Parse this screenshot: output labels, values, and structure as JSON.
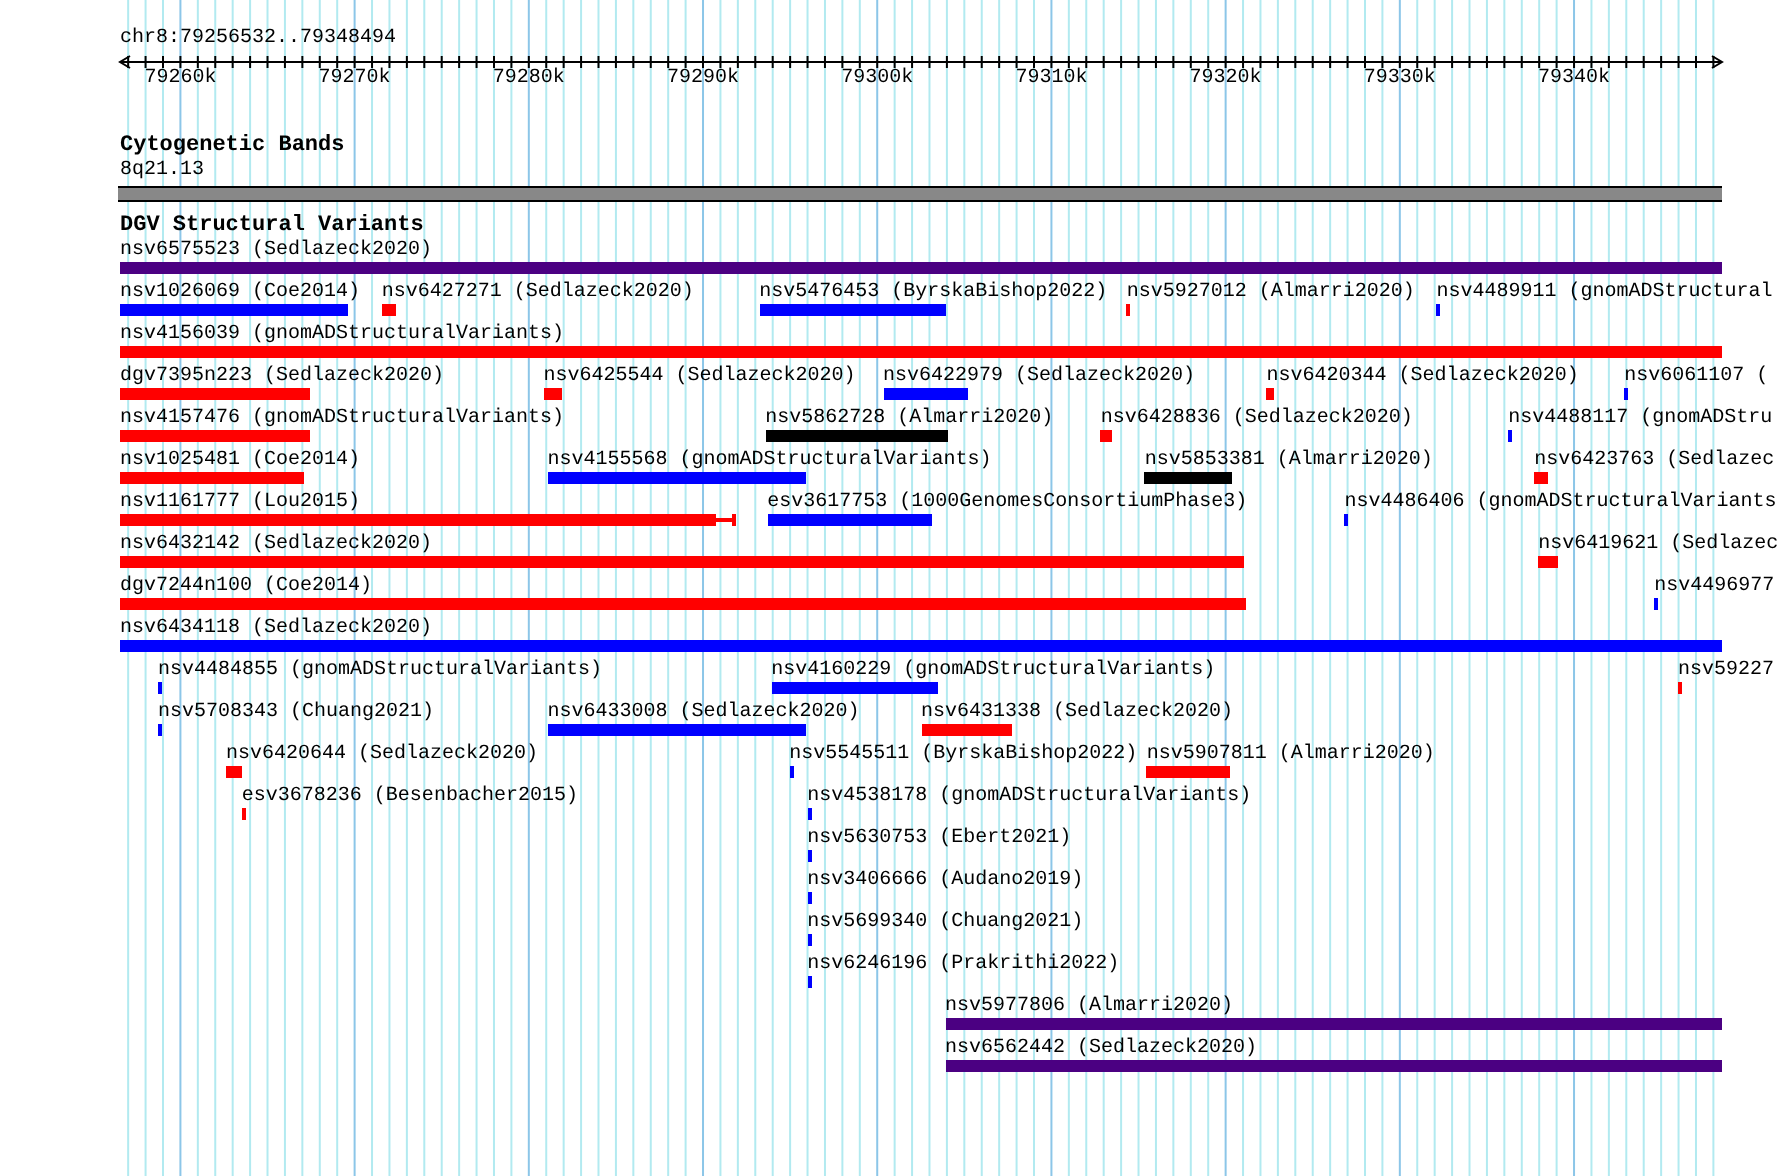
{
  "ruler": {
    "location": "chr8:79256532..79348494",
    "ticks": [
      {
        "label": "79260k"
      },
      {
        "label": "79270k"
      },
      {
        "label": "79280k"
      },
      {
        "label": "79290k"
      },
      {
        "label": "79300k"
      },
      {
        "label": "79310k"
      },
      {
        "label": "79320k"
      },
      {
        "label": "79330k"
      },
      {
        "label": "79340k"
      }
    ]
  },
  "cytogenetic_bands": {
    "title": "Cytogenetic Bands",
    "bands": [
      {
        "name": "8q21.13"
      }
    ]
  },
  "structural_variants": {
    "title": "DGV Structural Variants",
    "lanes": [
      {
        "features": [
          {
            "label": "nsv6575523 (Sedlazeck2020)",
            "color": "#4b0082"
          }
        ]
      },
      {
        "features": [
          {
            "label": "nsv1026069 (Coe2014)",
            "color": "#0000ff"
          },
          {
            "label": "nsv6427271 (Sedlazeck2020)",
            "color": "#ff0000"
          },
          {
            "label": "nsv5476453 (ByrskaBishop2022)",
            "color": "#0000ff"
          },
          {
            "label": "nsv5927012 (Almarri2020)",
            "color": "#ff0000"
          },
          {
            "label": "nsv4489911 (gnomADStructural",
            "color": "#0000ff"
          }
        ]
      },
      {
        "features": [
          {
            "label": "nsv4156039 (gnomADStructuralVariants)",
            "color": "#ff0000"
          }
        ]
      },
      {
        "features": [
          {
            "label": "dgv7395n223 (Sedlazeck2020)",
            "color": "#ff0000"
          },
          {
            "label": "nsv6425544 (Sedlazeck2020)",
            "color": "#ff0000"
          },
          {
            "label": "nsv6422979 (Sedlazeck2020)",
            "color": "#0000ff"
          },
          {
            "label": "nsv6420344 (Sedlazeck2020)",
            "color": "#ff0000"
          },
          {
            "label": "nsv6061107 (",
            "color": "#0000ff"
          }
        ]
      },
      {
        "features": [
          {
            "label": "nsv4157476 (gnomADStructuralVariants)",
            "color": "#ff0000"
          },
          {
            "label": "nsv5862728 (Almarri2020)",
            "color": "#000000"
          },
          {
            "label": "nsv6428836 (Sedlazeck2020)",
            "color": "#ff0000"
          },
          {
            "label": "nsv4488117 (gnomADStru",
            "color": "#0000ff"
          }
        ]
      },
      {
        "features": [
          {
            "label": "nsv1025481 (Coe2014)",
            "color": "#ff0000"
          },
          {
            "label": "nsv4155568 (gnomADStructuralVariants)",
            "color": "#0000ff"
          },
          {
            "label": "nsv5853381 (Almarri2020)",
            "color": "#000000"
          },
          {
            "label": "nsv6423763 (Sedlazec",
            "color": "#ff0000"
          }
        ]
      },
      {
        "features": [
          {
            "label": "nsv1161777 (Lou2015)",
            "color": "#ff0000"
          },
          {
            "label": "esv3617753 (1000GenomesConsortiumPhase3)",
            "color": "#0000ff"
          },
          {
            "label": "nsv4486406 (gnomADStructuralVariants",
            "color": "#0000ff"
          }
        ]
      },
      {
        "features": [
          {
            "label": "nsv6432142 (Sedlazeck2020)",
            "color": "#ff0000"
          },
          {
            "label": "nsv6419621 (Sedlazec",
            "color": "#ff0000"
          }
        ]
      },
      {
        "features": [
          {
            "label": "dgv7244n100 (Coe2014)",
            "color": "#ff0000"
          },
          {
            "label": "nsv4496977",
            "color": "#0000ff"
          }
        ]
      },
      {
        "features": [
          {
            "label": "nsv6434118 (Sedlazeck2020)",
            "color": "#0000ff"
          }
        ]
      },
      {
        "features": [
          {
            "label": "nsv4484855 (gnomADStructuralVariants)",
            "color": "#0000ff"
          },
          {
            "label": "nsv4160229 (gnomADStructuralVariants)",
            "color": "#0000ff"
          },
          {
            "label": "nsv59227",
            "color": "#ff0000"
          }
        ]
      },
      {
        "features": [
          {
            "label": "nsv5708343 (Chuang2021)",
            "color": "#0000ff"
          },
          {
            "label": "nsv6433008 (Sedlazeck2020)",
            "color": "#0000ff"
          },
          {
            "label": "nsv6431338 (Sedlazeck2020)",
            "color": "#ff0000"
          }
        ]
      },
      {
        "features": [
          {
            "label": "nsv6420644 (Sedlazeck2020)",
            "color": "#ff0000"
          },
          {
            "label": "nsv5545511 (ByrskaBishop2022)",
            "color": "#0000ff"
          },
          {
            "label": "nsv5907811 (Almarri2020)",
            "color": "#ff0000"
          }
        ]
      },
      {
        "features": [
          {
            "label": "esv3678236 (Besenbacher2015)",
            "color": "#ff0000"
          },
          {
            "label": "nsv4538178 (gnomADStructuralVariants)",
            "color": "#0000ff"
          }
        ]
      },
      {
        "features": [
          {
            "label": "nsv5630753 (Ebert2021)",
            "color": "#0000ff"
          }
        ]
      },
      {
        "features": [
          {
            "label": "nsv3406666 (Audano2019)",
            "color": "#0000ff"
          }
        ]
      },
      {
        "features": [
          {
            "label": "nsv5699340 (Chuang2021)",
            "color": "#0000ff"
          }
        ]
      },
      {
        "features": [
          {
            "label": "nsv6246196 (Prakrithi2022)",
            "color": "#0000ff"
          }
        ]
      },
      {
        "features": [
          {
            "label": "nsv5977806 (Almarri2020)",
            "color": "#4b0082"
          }
        ]
      },
      {
        "features": [
          {
            "label": "nsv6562442 (Sedlazeck2020)",
            "color": "#4b0082"
          }
        ]
      }
    ]
  }
}
